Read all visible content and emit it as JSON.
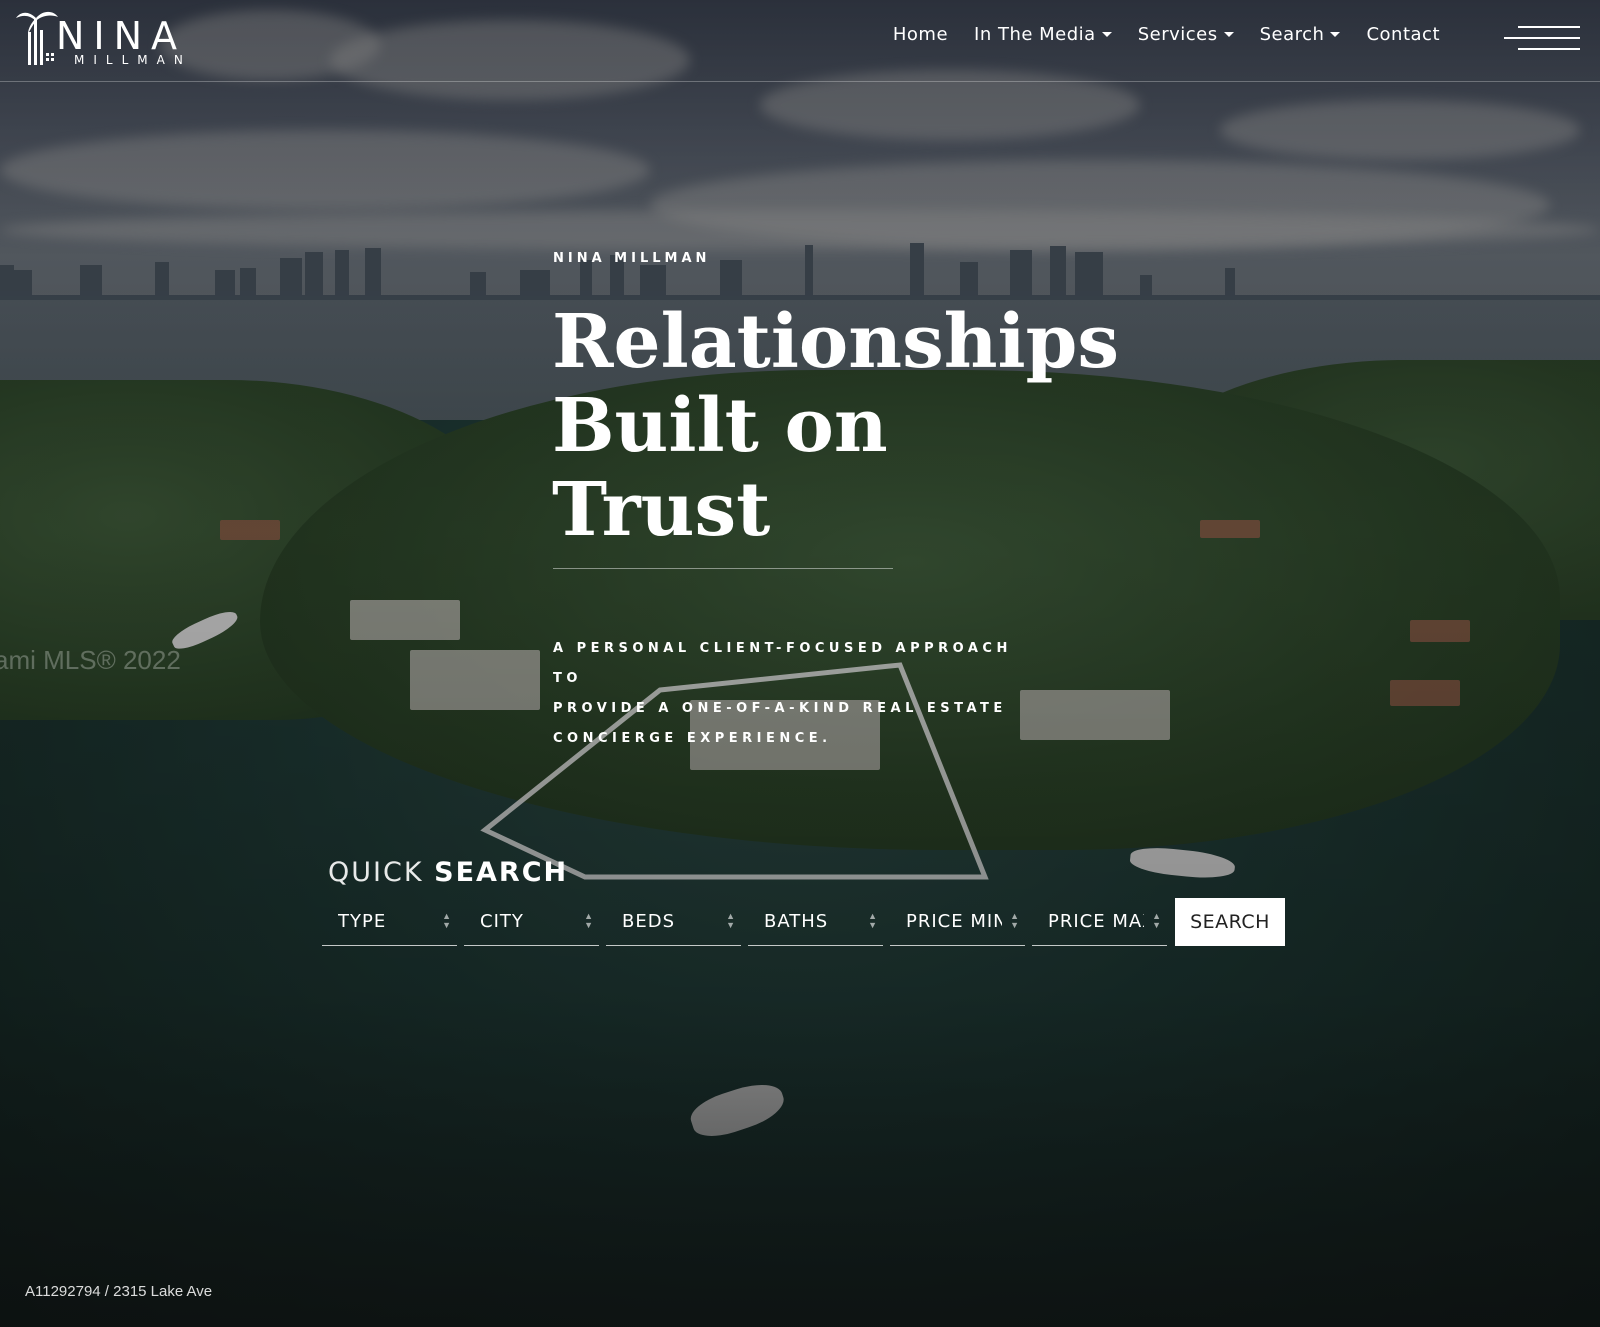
{
  "brand": {
    "name": "NINA",
    "sub": "MILLMAN"
  },
  "nav": {
    "items": [
      {
        "label": "Home",
        "dropdown": false
      },
      {
        "label": "In The Media",
        "dropdown": true
      },
      {
        "label": "Services",
        "dropdown": true
      },
      {
        "label": "Search",
        "dropdown": true
      },
      {
        "label": "Contact",
        "dropdown": false
      }
    ],
    "menu_icon": "hamburger-menu-icon"
  },
  "hero": {
    "eyebrow": "NINA MILLMAN",
    "headline_line1": "Relationships",
    "headline_line2": "Built on",
    "headline_line3": "Trust",
    "tagline_line1": "A PERSONAL CLIENT-FOCUSED APPROACH TO",
    "tagline_line2": "PROVIDE A ONE-OF-A-KIND REAL ESTATE",
    "tagline_line3": "CONCIERGE EXPERIENCE.",
    "watermark": "ami MLS® 2022"
  },
  "quick_search": {
    "title_light": "QUICK",
    "title_bold": "SEARCH",
    "fields": [
      {
        "label": "TYPE"
      },
      {
        "label": "CITY"
      },
      {
        "label": "BEDS"
      },
      {
        "label": "BATHS"
      },
      {
        "label": "PRICE MIN"
      },
      {
        "label": "PRICE MAX"
      }
    ],
    "button_label": "SEARCH"
  },
  "listing_caption": "A11292794 / 2315 Lake Ave",
  "colors": {
    "overlay": "#000000",
    "button_bg": "#ffffff",
    "button_text": "#222222"
  }
}
